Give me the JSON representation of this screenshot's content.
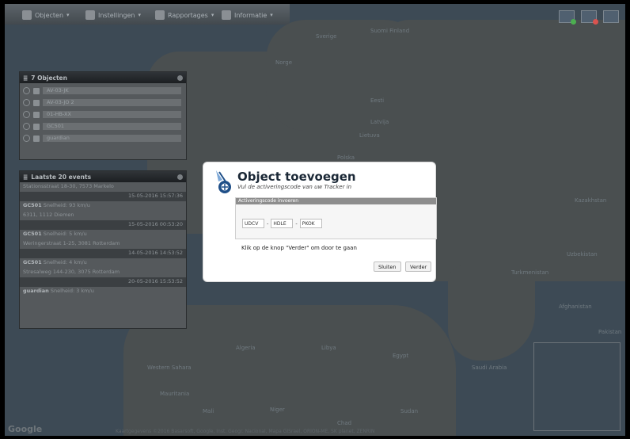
{
  "menu": [
    {
      "label": "Objecten",
      "icon": "car-icon"
    },
    {
      "label": "Instellingen",
      "icon": "wrench-icon"
    },
    {
      "label": "Rapportages",
      "icon": "report-icon"
    },
    {
      "label": "Informatie",
      "icon": "info-icon"
    }
  ],
  "objects_panel": {
    "title": "7 Objecten",
    "items": [
      {
        "label": "AV-03-JK",
        "icon": "car-icon"
      },
      {
        "label": "AV-03-JO 2",
        "icon": "people-icon"
      },
      {
        "label": "01-HB-XX",
        "icon": "bus-icon"
      },
      {
        "label": "GC501",
        "icon": "car-icon"
      },
      {
        "label": "guardian",
        "icon": "person-icon"
      }
    ]
  },
  "events_panel": {
    "title": "Laatste 20 events",
    "rows": [
      {
        "text": "Stationsstraat 18-30, 7573 Markelo",
        "type": "addr"
      },
      {
        "text": "15-05-2016 15:57:36",
        "type": "time"
      },
      {
        "name": "GC501",
        "text": "Snelheid: 93 km/u",
        "type": "speed"
      },
      {
        "text": "6311, 1112 Diemen",
        "type": "addr"
      },
      {
        "text": "15-05-2016 00:53:20",
        "type": "time"
      },
      {
        "name": "GC501",
        "text": "Snelheid: 5 km/u",
        "type": "speed"
      },
      {
        "text": "Weringerstraat 1-25, 3081 Rotterdam",
        "type": "addr"
      },
      {
        "text": "14-05-2016 14:53:52",
        "type": "time"
      },
      {
        "name": "GC501",
        "text": "Snelheid: 4 km/u",
        "type": "speed"
      },
      {
        "text": "Stresalweg 144-230, 3075 Rotterdam",
        "type": "addr"
      },
      {
        "text": "20-05-2016 15:53:52",
        "type": "time"
      },
      {
        "name": "guardian",
        "text": "Snelheid: 3 km/u",
        "type": "speed"
      }
    ]
  },
  "modal": {
    "title": "Object toevoegen",
    "subtitle": "Vul de activeringscode van uw Tracker in",
    "section_title": "Activeringscode invoeren",
    "code": [
      "UDCV",
      "HDLE",
      "PKOK"
    ],
    "separator": "-",
    "message": "Klik op de knop \"Verder\" om door te gaan",
    "close_label": "Sluiten",
    "next_label": "Verder"
  },
  "map_labels": [
    "Sverige",
    "Suomi Finland",
    "Norge",
    "Eesti",
    "Latvija",
    "Lietuva",
    "Polska",
    "Kazakhstan",
    "Turkmenistan",
    "Uzbekistan",
    "Afghanistan",
    "Pakistan",
    "Algeria",
    "Mali",
    "Niger",
    "Chad",
    "Sudan",
    "Libya",
    "Egypt",
    "Mauritania",
    "Western Sahara",
    "Saudi Arabia"
  ],
  "google_label": "Google",
  "attribution": "Kaartgegevens ©2016 Basarsoft, Google, Inst. Geogr. Nacional, Mapa GISrael, ORION-ME, SK planet, ZENRIN"
}
